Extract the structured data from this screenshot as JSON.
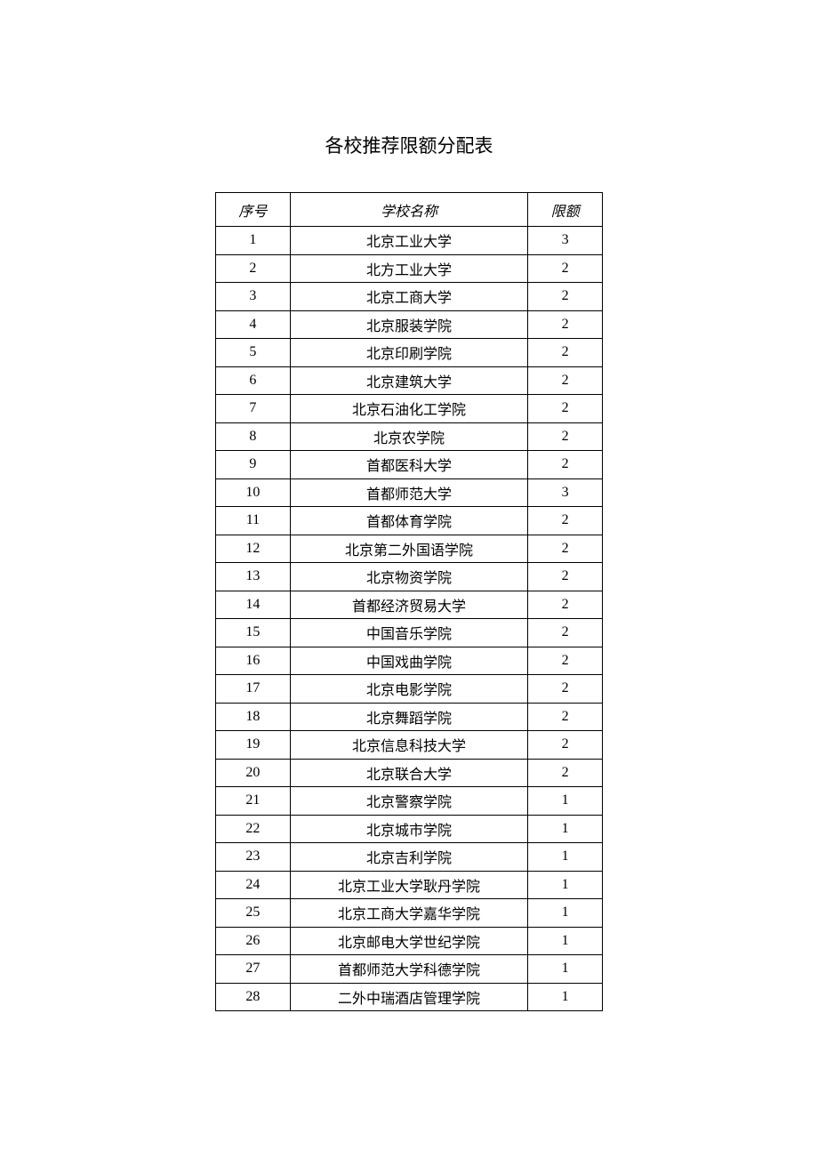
{
  "title": "各校推荐限额分配表",
  "headers": {
    "seq": "序号",
    "name": "学校名称",
    "quota": "限额"
  },
  "rows": [
    {
      "seq": "1",
      "name": "北京工业大学",
      "quota": "3"
    },
    {
      "seq": "2",
      "name": "北方工业大学",
      "quota": "2"
    },
    {
      "seq": "3",
      "name": "北京工商大学",
      "quota": "2"
    },
    {
      "seq": "4",
      "name": "北京服装学院",
      "quota": "2"
    },
    {
      "seq": "5",
      "name": "北京印刷学院",
      "quota": "2"
    },
    {
      "seq": "6",
      "name": "北京建筑大学",
      "quota": "2"
    },
    {
      "seq": "7",
      "name": "北京石油化工学院",
      "quota": "2"
    },
    {
      "seq": "8",
      "name": "北京农学院",
      "quota": "2"
    },
    {
      "seq": "9",
      "name": "首都医科大学",
      "quota": "2"
    },
    {
      "seq": "10",
      "name": "首都师范大学",
      "quota": "3"
    },
    {
      "seq": "11",
      "name": "首都体育学院",
      "quota": "2"
    },
    {
      "seq": "12",
      "name": "北京第二外国语学院",
      "quota": "2"
    },
    {
      "seq": "13",
      "name": "北京物资学院",
      "quota": "2"
    },
    {
      "seq": "14",
      "name": "首都经济贸易大学",
      "quota": "2"
    },
    {
      "seq": "15",
      "name": "中国音乐学院",
      "quota": "2"
    },
    {
      "seq": "16",
      "name": "中国戏曲学院",
      "quota": "2"
    },
    {
      "seq": "17",
      "name": "北京电影学院",
      "quota": "2"
    },
    {
      "seq": "18",
      "name": "北京舞蹈学院",
      "quota": "2"
    },
    {
      "seq": "19",
      "name": "北京信息科技大学",
      "quota": "2"
    },
    {
      "seq": "20",
      "name": "北京联合大学",
      "quota": "2"
    },
    {
      "seq": "21",
      "name": "北京警察学院",
      "quota": "1"
    },
    {
      "seq": "22",
      "name": "北京城市学院",
      "quota": "1"
    },
    {
      "seq": "23",
      "name": "北京吉利学院",
      "quota": "1"
    },
    {
      "seq": "24",
      "name": "北京工业大学耿丹学院",
      "quota": "1"
    },
    {
      "seq": "25",
      "name": "北京工商大学嘉华学院",
      "quota": "1"
    },
    {
      "seq": "26",
      "name": "北京邮电大学世纪学院",
      "quota": "1"
    },
    {
      "seq": "27",
      "name": "首都师范大学科德学院",
      "quota": "1"
    },
    {
      "seq": "28",
      "name": "二外中瑞酒店管理学院",
      "quota": "1"
    }
  ]
}
